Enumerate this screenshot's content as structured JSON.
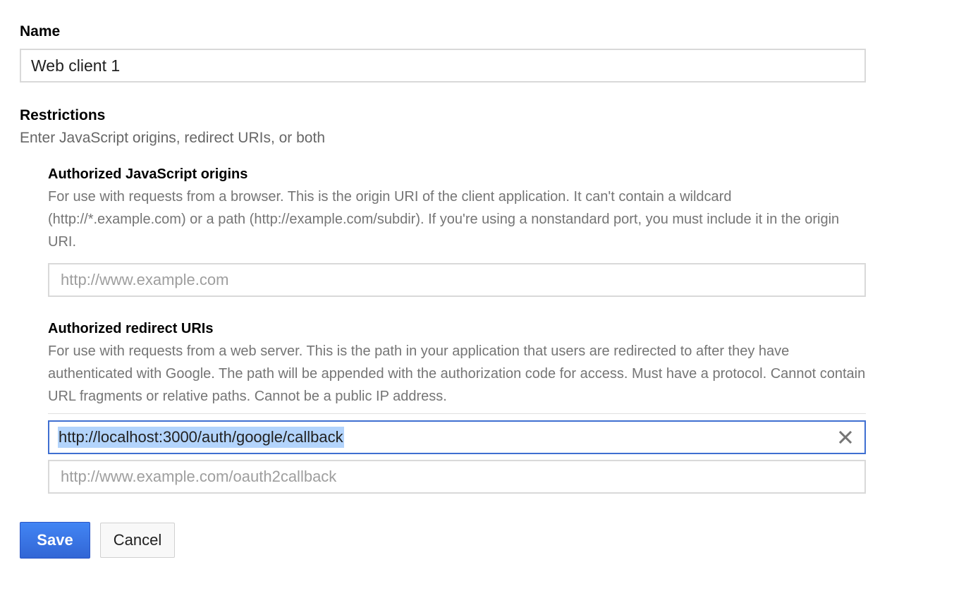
{
  "form": {
    "name_label": "Name",
    "name_value": "Web client 1"
  },
  "restrictions": {
    "title": "Restrictions",
    "hint": "Enter JavaScript origins, redirect URIs, or both",
    "js_origins": {
      "title": "Authorized JavaScript origins",
      "description": "For use with requests from a browser. This is the origin URI of the client application. It can't contain a wildcard (http://*.example.com) or a path (http://example.com/subdir). If you're using a nonstandard port, you must include it in the origin URI.",
      "placeholder": "http://www.example.com"
    },
    "redirect_uris": {
      "title": "Authorized redirect URIs",
      "description": "For use with requests from a web server. This is the path in your application that users are redirected to after they have authenticated with Google. The path will be appended with the authorization code for access. Must have a protocol. Cannot contain URL fragments or relative paths. Cannot be a public IP address.",
      "entries": [
        "http://localhost:3000/auth/google/callback"
      ],
      "placeholder": "http://www.example.com/oauth2callback",
      "clear_icon": "close-icon"
    }
  },
  "actions": {
    "save_label": "Save",
    "cancel_label": "Cancel"
  },
  "colors": {
    "primary": "#4285f4",
    "focus_border": "#3f6fd1",
    "selection": "#b3d4fc"
  }
}
